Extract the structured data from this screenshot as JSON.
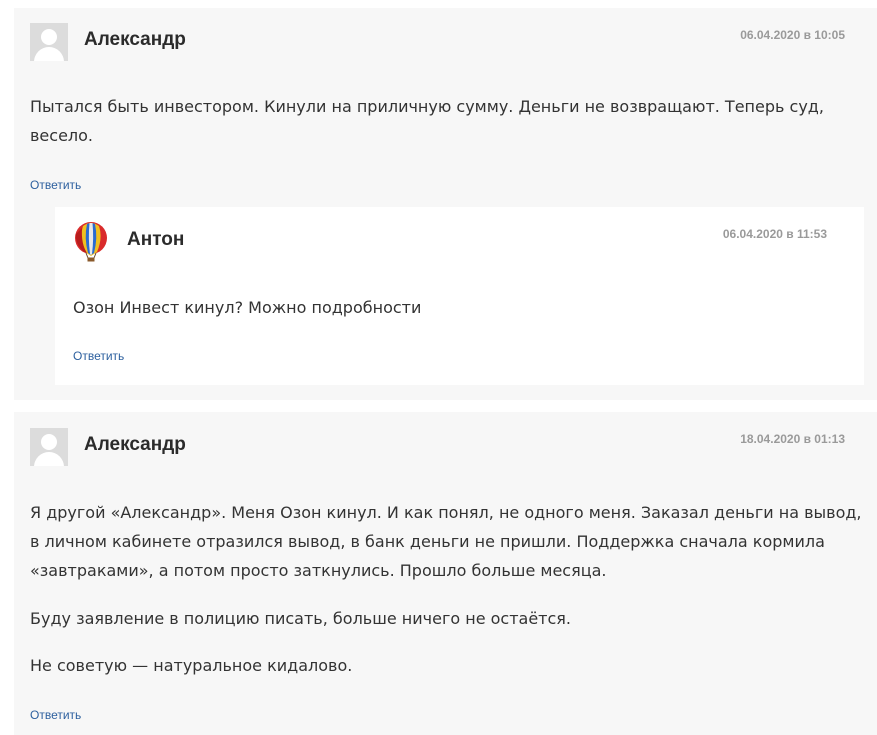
{
  "comments": [
    {
      "author": "Александр",
      "date": "06.04.2020 в 10:05",
      "paragraphs": [
        "Пытался быть инвестором. Кинули на приличную сумму. Деньги не возвращают. Теперь суд, весело."
      ],
      "reply_label": "Ответить",
      "avatar_icon": "default-user-icon"
    },
    {
      "author": "Антон",
      "date": "06.04.2020 в 11:53",
      "paragraphs": [
        "Озон Инвест кинул? Можно подробности"
      ],
      "reply_label": "Ответить",
      "avatar_icon": "hot-air-balloon-icon"
    },
    {
      "author": "Александр",
      "date": "18.04.2020 в 01:13",
      "paragraphs": [
        "Я другой «Александр». Меня Озон кинул. И как понял, не одного меня. Заказал деньги на вывод, в личном кабинете отразился вывод, в банк деньги не пришли. Поддержка сначала кормила «завтраками», а потом просто заткнулись. Прошло больше месяца.",
        "Буду заявление в полицию писать, больше ничего не остаётся.",
        "Не советую — натуральное кидалово."
      ],
      "reply_label": "Ответить",
      "avatar_icon": "default-user-icon"
    }
  ],
  "colors": {
    "comment_bg": "#f7f7f7",
    "reply_bg": "#ffffff",
    "link": "#2c5f9e",
    "date": "#9a9a9a",
    "author": "#2b2b2b"
  }
}
